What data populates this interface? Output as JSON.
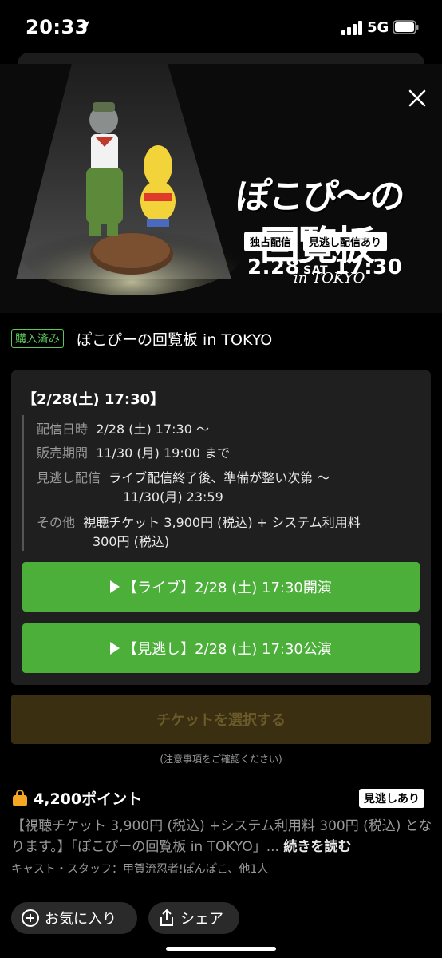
{
  "status_bar": {
    "time": "20:33",
    "network": "5G",
    "icons": [
      "location-arrow-icon",
      "signal-bars-icon",
      "battery-icon"
    ]
  },
  "hero": {
    "logo_line1": "ぽこぴ〜の",
    "logo_line2": "回覧板",
    "logo_sub": "in TOKYO",
    "badges": [
      "独占配信",
      "見逃し配信あり"
    ],
    "date": "2.28",
    "day": "SAT",
    "time": "17:30",
    "close_icon": "close-icon"
  },
  "event": {
    "purchased_label": "購入済み",
    "title": "ぽこぴーの回覧板 in TOKYO"
  },
  "detail": {
    "date_header": "【2/28(土) 17:30】",
    "rows": [
      {
        "label": "配信日時",
        "value": "2/28 (土) 17:30 〜"
      },
      {
        "label": "販売期間",
        "value": "11/30 (月) 19:00 まで"
      },
      {
        "label": "見逃し配信",
        "value": "ライブ配信終了後、準備が整い次第 〜",
        "value2": "11/30(月) 23:59"
      },
      {
        "label": "その他",
        "value": "視聴チケット 3,900円 (税込) + システム利用料",
        "value2": "300円 (税込)"
      }
    ],
    "buttons": [
      "【ライブ】2/28 (土) 17:30開演",
      "【見逃し】2/28 (土) 17:30公演"
    ]
  },
  "select_ticket": "チケットを選択する",
  "notice": "(注意事項をご確認ください)",
  "points": {
    "text": "4,200ポイント",
    "badge": "見逃しあり",
    "icon": "bag-icon"
  },
  "description": {
    "text": "【視聴チケット 3,900円 (税込) +システム利用料 300円 (税込) となります。】「ぽこぴーの回覧板 in TOKYO」...",
    "read_more": "続きを読む",
    "cast": "キャスト・スタッフ：甲賀流忍者!ぽんぽこ、他1人"
  },
  "actions": {
    "favorite": "お気に入り",
    "share": "シェア"
  },
  "colors": {
    "accent_green": "#4caf3a",
    "disabled_button": "#3b2f12",
    "card_bg": "#1f1f1f",
    "points_icon": "#f5a623"
  }
}
